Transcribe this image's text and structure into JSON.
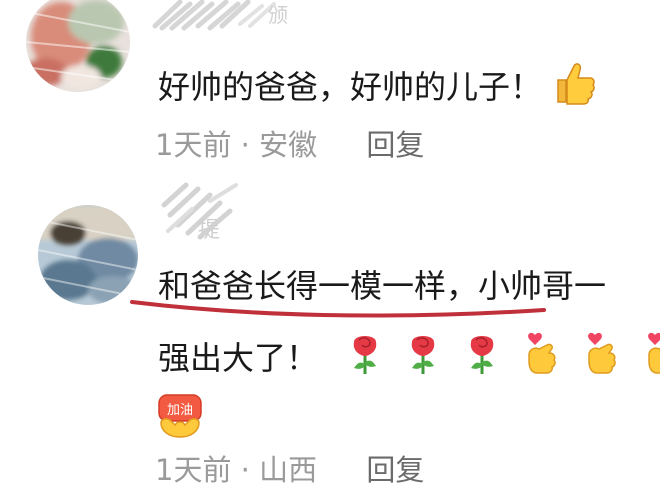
{
  "comments": [
    {
      "text": "好帅的爸爸，好帅的儿子！",
      "reaction_icons": [
        "thumbs-up-icon"
      ],
      "time": "1天前",
      "location": "安徽",
      "reply_label": "回复"
    },
    {
      "text_line1": "和爸爸长得一模一样，小帅哥一",
      "text_line2": "强出大了！",
      "reaction_icons": [
        "rose-icon",
        "rose-icon",
        "rose-icon",
        "finger-heart-icon",
        "finger-heart-icon",
        "finger-heart-icon",
        "jiayou-badge-icon"
      ],
      "badge_text": "加油",
      "time": "1天前",
      "location": "山西",
      "reply_label": "回复"
    }
  ],
  "colors": {
    "text": "#1a1a1a",
    "meta": "#9a9a9a",
    "underline": "#c0303a",
    "rose": "#e53945",
    "emoji_yellow": "#f7c631"
  }
}
